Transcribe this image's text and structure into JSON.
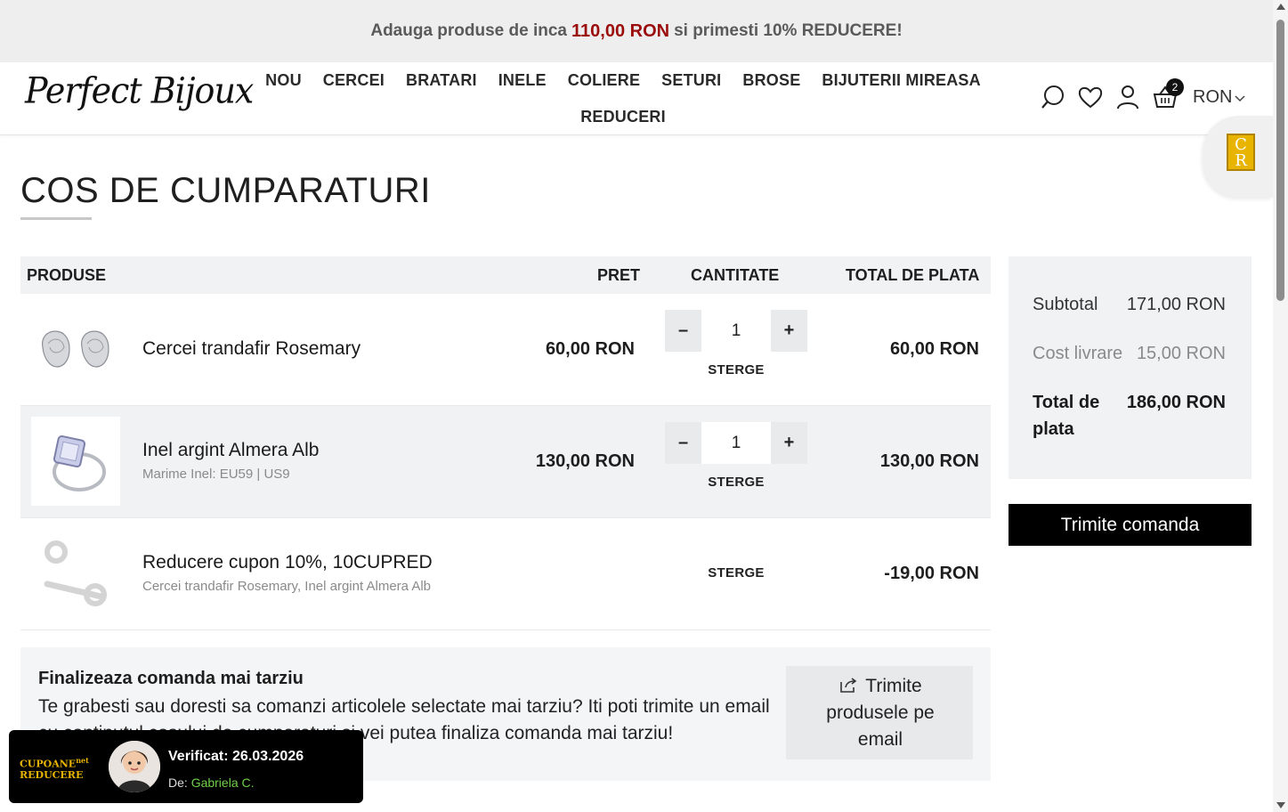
{
  "promo": {
    "prefix": "Adauga produse de inca",
    "amount": "110,00 RON",
    "suffix": "si primesti 10% REDUCERE!"
  },
  "header": {
    "logo": "Perfect Bijoux",
    "nav_row1": [
      "NOU",
      "CERCEI",
      "BRATARI",
      "INELE",
      "COLIERE",
      "SETURI",
      "BROSE",
      "BIJUTERII MIREASA"
    ],
    "nav_row2": [
      "REDUCERI"
    ],
    "cart_count": "2",
    "currency": "RON",
    "icons": [
      "search-icon",
      "heart-icon",
      "user-icon",
      "basket-icon",
      "chevron-down-icon"
    ]
  },
  "widget": {
    "letters": "CR"
  },
  "page": {
    "title": "COS DE CUMPARATURI"
  },
  "cart": {
    "headers": {
      "products": "PRODUSE",
      "price": "PRET",
      "quantity": "CANTITATE",
      "total": "TOTAL DE PLATA"
    },
    "items": [
      {
        "name": "Cercei trandafir Rosemary",
        "sub": "",
        "price": "60,00 RON",
        "qty": "1",
        "total": "60,00 RON",
        "remove": "STERGE",
        "minus": "–",
        "plus": "+"
      },
      {
        "name": "Inel argint Almera Alb",
        "sub": "Marime Inel: EU59 | US9",
        "price": "130,00 RON",
        "qty": "1",
        "total": "130,00 RON",
        "remove": "STERGE",
        "minus": "–",
        "plus": "+"
      },
      {
        "name": "Reducere cupon 10%, 10CUPRED",
        "sub": "Cercei trandafir Rosemary, Inel argint Almera Alb",
        "total": "-19,00 RON",
        "remove": "STERGE"
      }
    ]
  },
  "summary": {
    "subtotal_label": "Subtotal",
    "subtotal_value": "171,00 RON",
    "shipping_label": "Cost livrare",
    "shipping_value": "15,00 RON",
    "total_label_1": "Total de",
    "total_label_2": "plata",
    "total_value": "186,00 RON",
    "checkout": "Trimite comanda"
  },
  "later": {
    "title": "Finalizeaza comanda mai tarziu",
    "text": "Te grabesti sau doresti sa comanzi articolele selectate mai tarziu? Iti poti trimite un email cu continutul cosului de cumparaturi si vei putea finaliza comanda mai tarziu!",
    "button": "Trimite produsele pe email"
  },
  "verified": {
    "logo_line1": "CUPOANE",
    "logo_sup": "net",
    "logo_line2": "REDUCERE",
    "title": "Verificat: 26.03.2026",
    "by_label": "De:",
    "by_name": "Gabriela C."
  },
  "colors": {
    "promo_amount": "#9b0c0c",
    "accent_dark": "#000000",
    "verified_name": "#6fcf4a",
    "widget_gold": "#e8b400"
  }
}
